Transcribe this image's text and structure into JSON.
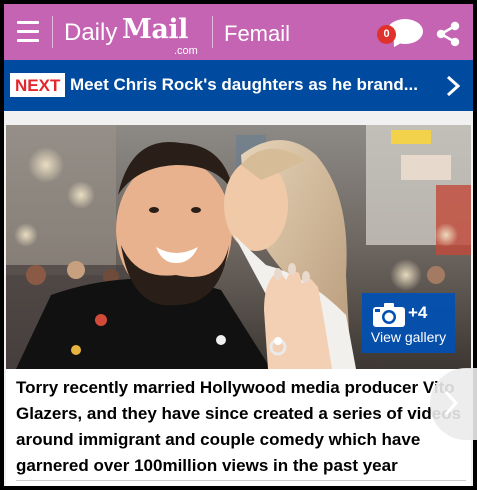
{
  "header": {
    "logo_daily": "Daily",
    "logo_mail": "Mail",
    "logo_com": ".com",
    "channel": "Femail",
    "notification_count": "0",
    "menu_icon": "hamburger-menu-icon",
    "notification_icon": "chat-bubble-icon",
    "share_icon": "share-icon",
    "bg_color": "#c464b3"
  },
  "next_bar": {
    "tag": "NEXT",
    "title": "Meet Chris Rock's daughters as he brand...",
    "chevron_icon": "chevron-right-icon",
    "bg_color": "#004a9f"
  },
  "article": {
    "gallery_count": "+4",
    "gallery_label": "View gallery",
    "gallery_icon": "camera-icon",
    "caption": "Torry recently married Hollywood media producer Vito Glazers, and they have since created a series of videos around immigrant and couple comedy which have garnered over 100million views in the past year"
  }
}
